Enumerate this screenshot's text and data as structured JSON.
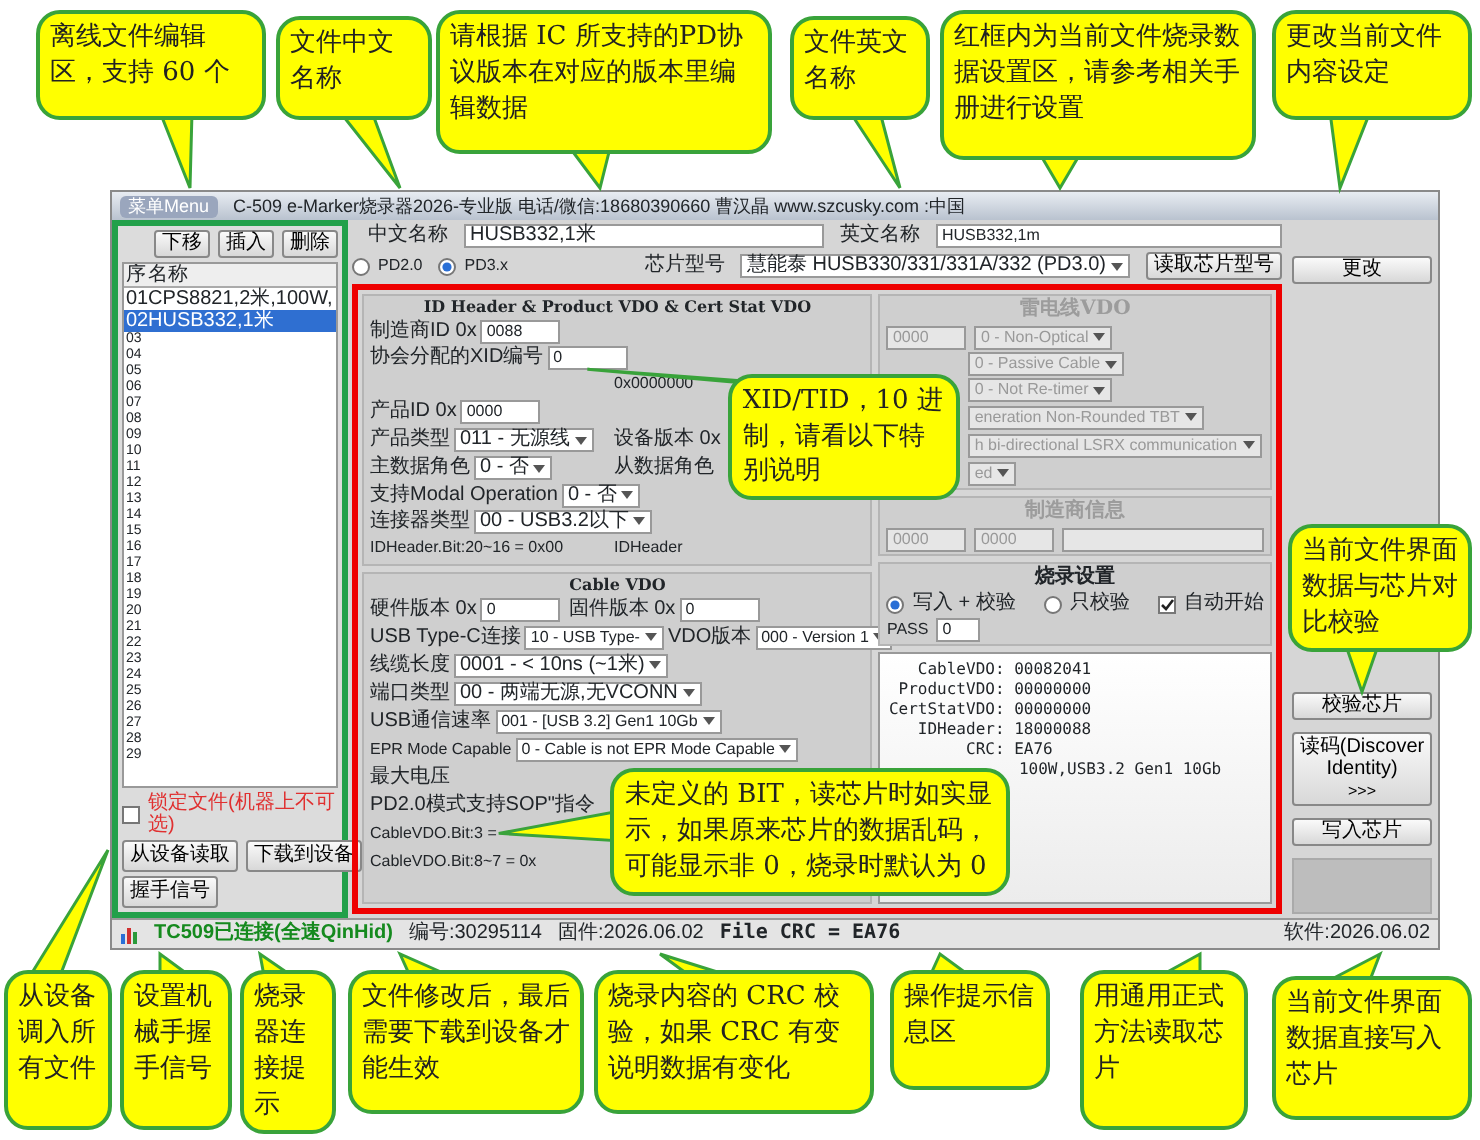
{
  "window": {
    "menu_button": "菜单Menu",
    "title": "C-509 e-Marker烧录器2026-专业版 电话/微信:18680390660 曹汉晶 www.szcusky.com :中国"
  },
  "file_list": {
    "buttons": [
      "下移",
      "插入",
      "删除"
    ],
    "columns": [
      "序",
      "名称"
    ],
    "rows": [
      {
        "index": "01",
        "name": "CPS8821,2米,100W,",
        "selected": false
      },
      {
        "index": "02",
        "name": "HUSB332,1米",
        "selected": true
      },
      {
        "index": "03",
        "selected": false
      },
      {
        "index": "04",
        "selected": false
      },
      {
        "index": "05",
        "selected": false
      },
      {
        "index": "06",
        "selected": false
      },
      {
        "index": "07",
        "selected": false
      },
      {
        "index": "08",
        "selected": false
      },
      {
        "index": "09",
        "selected": false
      },
      {
        "index": "10",
        "selected": false
      },
      {
        "index": "11",
        "selected": false
      },
      {
        "index": "12",
        "selected": false
      },
      {
        "index": "13",
        "selected": false
      },
      {
        "index": "14",
        "selected": false
      },
      {
        "index": "15",
        "selected": false
      },
      {
        "index": "16",
        "selected": false
      },
      {
        "index": "17",
        "selected": false
      },
      {
        "index": "18",
        "selected": false
      },
      {
        "index": "19",
        "selected": false
      },
      {
        "index": "20",
        "selected": false
      },
      {
        "index": "21",
        "selected": false
      },
      {
        "index": "22",
        "selected": false
      },
      {
        "index": "23",
        "selected": false
      },
      {
        "index": "24",
        "selected": false
      },
      {
        "index": "25",
        "selected": false
      },
      {
        "index": "26",
        "selected": false
      },
      {
        "index": "27",
        "selected": false
      },
      {
        "index": "28",
        "selected": false
      },
      {
        "index": "29",
        "selected": false
      }
    ],
    "lock": {
      "label": "锁定文件(机器上不可选)",
      "checked": false
    },
    "actions": [
      "从设备读取",
      "下载到设备"
    ],
    "handshake_button": "握手信号"
  },
  "names": {
    "chinese_label": "中文名称",
    "chinese_value": "HUSB332,1米",
    "english_label": "英文名称",
    "english_value": "HUSB332,1m"
  },
  "protocol": [
    {
      "label": "PD2.0",
      "selected": false
    },
    {
      "label": "PD3.x",
      "selected": true
    }
  ],
  "chip": {
    "label": "芯片型号",
    "value": "慧能泰 HUSB330/331/331A/332 (PD3.0)",
    "read_button": "读取芯片型号"
  },
  "id_section": {
    "title": "ID Header & Product VDO & Cert Stat VDO",
    "disabled": false,
    "rows": [
      [
        {
          "kind": "text",
          "label": "制造商ID 0x",
          "value": "0088"
        },
        {
          "kind": "text",
          "label": "协会分配的XID编号",
          "value": "0"
        }
      ],
      [
        {
          "kind": "note",
          "text": ""
        },
        {
          "kind": "note",
          "text": "0x0000000"
        }
      ],
      [
        {
          "kind": "text",
          "label": "产品ID 0x",
          "value": "0000"
        }
      ],
      [
        {
          "kind": "select",
          "label": "产品类型",
          "value": "011 - 无源线"
        },
        {
          "kind": "label",
          "text": "设备版本 0x"
        }
      ],
      [
        {
          "kind": "select",
          "label": "主数据角色",
          "value": "0 - 否"
        },
        {
          "kind": "label",
          "text": "从数据角色"
        }
      ],
      [
        {
          "kind": "select",
          "label": "支持Modal Operation",
          "value": "0 - 否"
        },
        {
          "kind": "select",
          "label": "连接器类型",
          "value": "00 - USB3.2以下"
        }
      ],
      [
        {
          "kind": "note",
          "text": "IDHeader.Bit:20~16 = 0x00"
        },
        {
          "kind": "note",
          "text": "IDHeader"
        }
      ]
    ]
  },
  "cable_section": {
    "title": "Cable VDO",
    "disabled": false,
    "rows": [
      [
        {
          "kind": "text",
          "label": "硬件版本 0x",
          "value": "0"
        },
        {
          "kind": "text",
          "label": "固件版本 0x",
          "value": "0"
        }
      ],
      [
        {
          "kind": "select",
          "label": "USB Type-C连接",
          "value": "10 - USB Type-"
        },
        {
          "kind": "select",
          "label": "VDO版本",
          "value": "000 - Version 1"
        }
      ],
      [
        {
          "kind": "select",
          "label": "线缆长度",
          "value": "0001 - < 10ns (~1米)"
        }
      ],
      [
        {
          "kind": "select",
          "label": "端口类型",
          "value": "00 - 两端无源,无VCONN"
        }
      ],
      [
        {
          "kind": "select",
          "label": "USB通信速率",
          "value": "001 - [USB 3.2] Gen1 10Gb"
        }
      ],
      [
        {
          "kind": "select",
          "label": "EPR Mode Capable",
          "value": "0 - Cable is not EPR Mode Capable"
        }
      ],
      [
        {
          "kind": "label",
          "text": "最大电压"
        }
      ],
      [
        {
          "kind": "note",
          "text": "PD2.0模式支持SOP\"指令"
        }
      ],
      [
        {
          "kind": "note",
          "text": "CableVDO.Bit:3 ="
        }
      ],
      [
        {
          "kind": "note",
          "text": "CableVDO.Bit:8~7 = 0x"
        }
      ]
    ]
  },
  "thunderbolt_section": {
    "title": "雷电线VDO",
    "disabled": true,
    "rows": [
      [
        {
          "kind": "text",
          "value": "0000"
        },
        {
          "kind": "select",
          "value": "0 - Non-Optical"
        }
      ],
      [
        {
          "kind": "select",
          "value": "0 - Passive Cable"
        },
        {
          "kind": "select",
          "value": "0 - Not Re-timer"
        }
      ],
      [
        {
          "kind": "select",
          "value": "eneration Non-Rounded TBT"
        }
      ],
      [
        {
          "kind": "select",
          "value": "h bi-directional LSRX communication"
        }
      ],
      [
        {
          "kind": "select",
          "value": "ed"
        }
      ]
    ]
  },
  "maker_section": {
    "title": "制造商信息",
    "disabled": true,
    "rows": [
      [
        {
          "kind": "text",
          "value": "0000"
        },
        {
          "kind": "text",
          "value": "0000"
        },
        {
          "kind": "text"
        }
      ]
    ]
  },
  "burn": {
    "title": "烧录设置",
    "modes": [
      {
        "label": "写入 + 校验",
        "selected": true
      },
      {
        "label": "只校验",
        "selected": false
      }
    ],
    "auto_start": {
      "label": "自动开始",
      "checked": true
    },
    "pass_label": "PASS",
    "pass_value": "0"
  },
  "log": [
    "   CableVDO: 00082041",
    " ProductVDO: 00000000",
    "CertStatVDO: 00000000",
    "   IDHeader: 18000088",
    "        CRC: EA76",
    "100W,USB3.2 Gen1 10Gb"
  ],
  "right_panel": {
    "change_button": "更改",
    "verify_button": "校验芯片",
    "read_button": "读码(Discover Identity)",
    "read_arrows": ">>>",
    "write_button": "写入芯片",
    "version": "软件:2026.06.02"
  },
  "status_bar": [
    {
      "kind": "connection",
      "text": "TC509已连接(全速QinHid)"
    },
    {
      "kind": "plain",
      "text": "编号:30295114"
    },
    {
      "kind": "plain",
      "text": "固件:2026.06.02"
    },
    {
      "kind": "crc",
      "text": "File CRC = EA76"
    }
  ],
  "callouts": [
    "离线文件编辑区，支持 60 个",
    "文件中文名称",
    "请根据 IC 所支持的PD协议版本在对应的版本里编辑数据",
    "文件英文名称",
    "红框内为当前文件烧录数据设置区，请参考相关手册进行设置",
    "更改当前文件内容设定",
    "XID/TID，10 进制，请看以下特别说明",
    "未定义的 BIT，读芯片时如实显示，如果原来芯片的数据乱码，可能显示非 0，烧录时默认为 0",
    "当前文件界面数据与芯片对比校验",
    "从设备调入所有文件",
    "设置机械手握手信号",
    "烧录器连接提示",
    "文件修改后，最后需要下载到设备才能生效",
    "烧录内容的 CRC 校验，如果 CRC 有变说明数据有变化",
    "操作提示信息区",
    "用通用正式方法读取芯片",
    "当前文件界面数据直接写入芯片"
  ]
}
